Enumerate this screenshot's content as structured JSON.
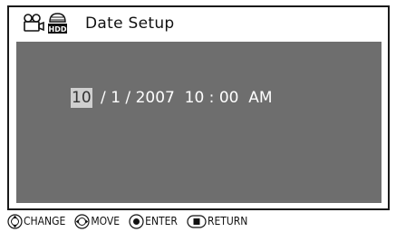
{
  "header": {
    "title": "Date Setup",
    "icons": [
      "camera-mode-icon",
      "hdd-icon"
    ],
    "hdd_label": "HDD"
  },
  "datetime": {
    "month": "10",
    "sep1": " / ",
    "day": "1",
    "sep2": " / ",
    "year": "2007",
    "gap": "  ",
    "hour": "10",
    "colon": " : ",
    "minute": "00",
    "ampm": "AM",
    "selected_field": "month"
  },
  "footer": {
    "change_label": "CHANGE",
    "move_label": "MOVE",
    "enter_label": "ENTER",
    "return_label": "RETURN"
  },
  "colors": {
    "screen_bg": "#6e6e6e",
    "highlight": "#cfcfcf",
    "text_on_screen": "#ffffff"
  }
}
